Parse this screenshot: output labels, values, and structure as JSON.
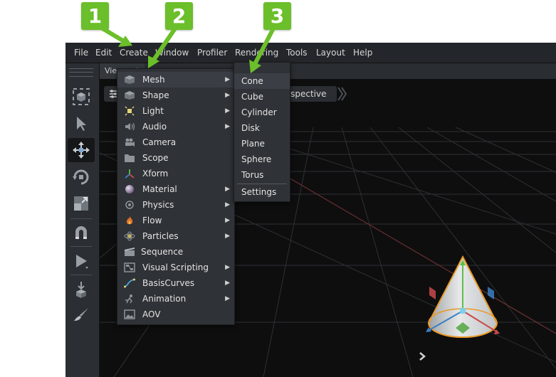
{
  "menubar": {
    "items": [
      "File",
      "Edit",
      "Create",
      "Window",
      "Profiler",
      "Rendering",
      "Tools",
      "Layout",
      "Help"
    ]
  },
  "viewport": {
    "tab_label": "Viewport",
    "camera_label": "Perspective"
  },
  "create_menu": {
    "items": [
      {
        "label": "Mesh",
        "icon": "cube-icon",
        "submenu": true
      },
      {
        "label": "Shape",
        "icon": "cube-icon",
        "submenu": true
      },
      {
        "label": "Light",
        "icon": "light-icon",
        "submenu": true
      },
      {
        "label": "Audio",
        "icon": "speaker-icon",
        "submenu": true
      },
      {
        "label": "Camera",
        "icon": "camera-icon",
        "submenu": false
      },
      {
        "label": "Scope",
        "icon": "folder-icon",
        "submenu": false
      },
      {
        "label": "Xform",
        "icon": "xform-axes-icon",
        "submenu": false
      },
      {
        "label": "Material",
        "icon": "sphere-icon",
        "submenu": true
      },
      {
        "label": "Physics",
        "icon": "physics-icon",
        "submenu": true
      },
      {
        "label": "Flow",
        "icon": "flame-icon",
        "submenu": true
      },
      {
        "label": "Particles",
        "icon": "particles-icon",
        "submenu": true
      },
      {
        "label": "Sequence",
        "icon": "film-icon",
        "submenu": false
      },
      {
        "label": "Visual Scripting",
        "icon": "graph-icon",
        "submenu": true
      },
      {
        "label": "BasisCurves",
        "icon": "curve-icon",
        "submenu": true
      },
      {
        "label": "Animation",
        "icon": "animation-icon",
        "submenu": true
      },
      {
        "label": "AOV",
        "icon": "image-icon",
        "submenu": false
      }
    ]
  },
  "mesh_submenu": {
    "items": [
      "Cone",
      "Cube",
      "Cylinder",
      "Disk",
      "Plane",
      "Sphere",
      "Torus"
    ],
    "settings_label": "Settings"
  },
  "callouts": [
    "1",
    "2",
    "3"
  ],
  "colors": {
    "accent_green": "#6bbf2a",
    "menu_bg": "#2f3236",
    "gizmo_y": "#5fbf4a",
    "gizmo_x": "#c94a4a",
    "gizmo_z": "#3b7fc4",
    "selection_outline": "#e89a2a"
  }
}
